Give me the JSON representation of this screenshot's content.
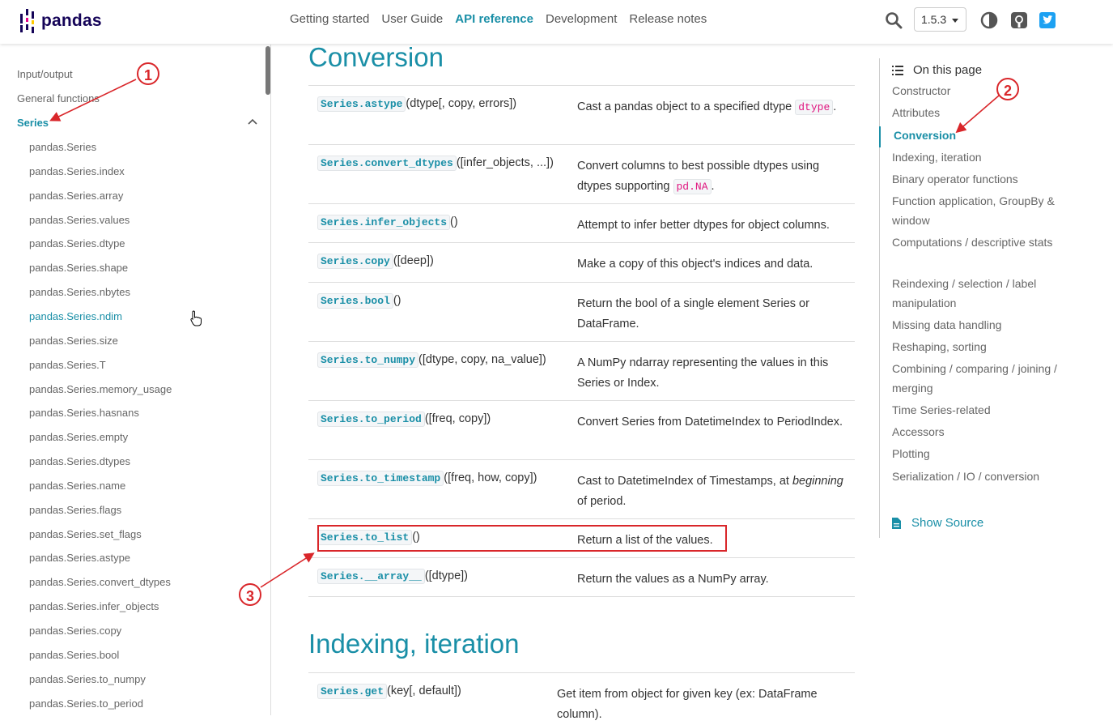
{
  "header": {
    "logo_text": "pandas",
    "nav": [
      "Getting started",
      "User Guide",
      "API reference",
      "Development",
      "Release notes"
    ],
    "active_nav": "API reference",
    "version": "1.5.3"
  },
  "sidebar": {
    "top_items": [
      "Input/output",
      "General functions"
    ],
    "section": "Series",
    "items": [
      "pandas.Series",
      "pandas.Series.index",
      "pandas.Series.array",
      "pandas.Series.values",
      "pandas.Series.dtype",
      "pandas.Series.shape",
      "pandas.Series.nbytes",
      "pandas.Series.ndim",
      "pandas.Series.size",
      "pandas.Series.T",
      "pandas.Series.memory_usage",
      "pandas.Series.hasnans",
      "pandas.Series.empty",
      "pandas.Series.dtypes",
      "pandas.Series.name",
      "pandas.Series.flags",
      "pandas.Series.set_flags",
      "pandas.Series.astype",
      "pandas.Series.convert_dtypes",
      "pandas.Series.infer_objects",
      "pandas.Series.copy",
      "pandas.Series.bool",
      "pandas.Series.to_numpy",
      "pandas.Series.to_period"
    ],
    "active_item": "pandas.Series.ndim"
  },
  "main": {
    "section1_title": "Conversion",
    "rows": [
      {
        "code": "Series.astype",
        "sig": "(dtype[, copy, errors])",
        "desc": "Cast a pandas object to a specified dtype",
        "inline": "dtype",
        "after": "."
      },
      {
        "code": "Series.convert_dtypes",
        "sig": "([infer_objects, ...])",
        "desc": "Convert columns to best possible dtypes using dtypes supporting",
        "inline": "pd.NA",
        "after": "."
      },
      {
        "code": "Series.infer_objects",
        "sig": "()",
        "desc": "Attempt to infer better dtypes for object columns."
      },
      {
        "code": "Series.copy",
        "sig": "([deep])",
        "desc": "Make a copy of this object's indices and data."
      },
      {
        "code": "Series.bool",
        "sig": "()",
        "desc": "Return the bool of a single element Series or DataFrame."
      },
      {
        "code": "Series.to_numpy",
        "sig": "([dtype, copy, na_value])",
        "desc": "A NumPy ndarray representing the values in this Series or Index."
      },
      {
        "code": "Series.to_period",
        "sig": "([freq, copy])",
        "desc": "Convert Series from DatetimeIndex to PeriodIndex."
      },
      {
        "code": "Series.to_timestamp",
        "sig": "([freq, how, copy])",
        "desc": "Cast to DatetimeIndex of Timestamps, at",
        "italic": "beginning",
        "after": " of period."
      },
      {
        "code": "Series.to_list",
        "sig": "()",
        "desc": "Return a list of the values."
      },
      {
        "code": "Series.__array__",
        "sig": "([dtype])",
        "desc": "Return the values as a NumPy array."
      }
    ],
    "section2_title": "Indexing, iteration",
    "rows2": [
      {
        "code": "Series.get",
        "sig": "(key[, default])",
        "desc": "Get item from object for given key (ex: DataFrame column)."
      }
    ]
  },
  "toc": {
    "heading": "On this page",
    "items": [
      "Constructor",
      "Attributes",
      "Conversion",
      "Indexing, iteration",
      "Binary operator functions",
      "Function application, GroupBy & window",
      "Computations / descriptive stats",
      "Reindexing / selection / label manipulation",
      "Missing data handling",
      "Reshaping, sorting",
      "Combining / comparing / joining / merging",
      "Time Series-related",
      "Accessors",
      "Plotting",
      "Serialization / IO / conversion"
    ],
    "active": "Conversion",
    "show_source": "Show Source"
  },
  "annotations": {
    "labels": [
      "1",
      "2",
      "3"
    ]
  },
  "colors": {
    "accent": "#1a8fa7",
    "annotation": "#d9262a",
    "brand": "#150458"
  }
}
